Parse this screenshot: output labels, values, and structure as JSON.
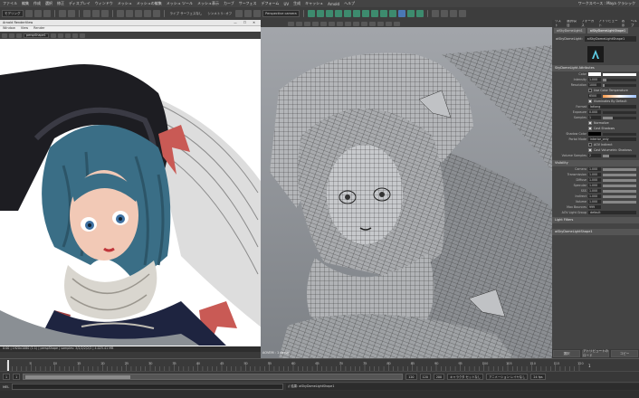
{
  "menubar": {
    "items": [
      "ファイル",
      "編集",
      "作成",
      "選択",
      "修正",
      "ディスプレイ",
      "ウィンドウ",
      "メッシュ",
      "メッシュの編集",
      "メッシュ ツール",
      "メッシュ表示",
      "カーブ",
      "サーフェス",
      "デフォーム",
      "UV",
      "生成",
      "キャッシュ",
      "Arnold",
      "ヘルプ"
    ],
    "workspace": "ワークスペース : Maya クラシック"
  },
  "toolbar": {
    "mode_select": "モデリング",
    "camera_select": "Perspective camera",
    "live_label": "ライブ サーフェスなし",
    "symmetry_label": "シンメトリ: オフ"
  },
  "render_view": {
    "title": "Arnold RenderView",
    "controls": "— ☐ ✕",
    "menu": [
      "Window",
      "View",
      "Render"
    ],
    "camera_dd": "perspShape1",
    "status": "0:00 | 1920x1080 (1:1) | perspShape | samples: 3/2/2/2/2/2 | 4.025.41 MB"
  },
  "viewport": {
    "camera_label": "AOVEM : 1  persp"
  },
  "attribute_editor": {
    "tabs": [
      "リスト",
      "選択項目",
      "フォーカス",
      "アトリビュート",
      "表示",
      "ヘルプ"
    ],
    "node_tabs": [
      "aiSkyDomeLight1",
      "aiSkyDomeLightShape1"
    ],
    "node_type_label": "aiSkyDomeLight:",
    "node_name": "aiSkyDomeLightShape1",
    "section1": "SkyDomeLight Attributes",
    "color_label": "Color",
    "intensity_label": "Intensity",
    "intensity_value": "1.000",
    "intensity_level": 0.1,
    "resolution_label": "Resolution",
    "resolution_value": "1000",
    "resolution_level": 0.05,
    "use_color_temp_label": "Use Color Temperature",
    "temperature_value": "6500",
    "illuminates_label": "Illuminates By Default",
    "format_label": "Format",
    "format_value": "latlong",
    "exposure_label": "Exposure",
    "exposure_value": "0.000",
    "samples_label": "Samples",
    "samples_value": "1",
    "samples_level": 0.3,
    "normalize_label": "Normalize",
    "cast_shadows_label": "Cast Shadows",
    "shadow_color_label": "Shadow Color",
    "portal_mode_label": "Portal Mode",
    "portal_mode_value": "interior_only",
    "aov_indirect_label": "AOV Indirect",
    "cast_volumetric_label": "Cast Volumetric Shadows",
    "volume_samples_label": "Volume Samples",
    "volume_samples_value": "2",
    "volume_samples_level": 0.2,
    "section2": "Visibility",
    "vis_rows": [
      {
        "label": "Camera",
        "value": "1.000"
      },
      {
        "label": "Transmission",
        "value": "1.000"
      },
      {
        "label": "Diffuse",
        "value": "1.000"
      },
      {
        "label": "Specular",
        "value": "1.000"
      },
      {
        "label": "SSS",
        "value": "1.000"
      },
      {
        "label": "Indirect",
        "value": "1.000"
      },
      {
        "label": "Volume",
        "value": "1.000"
      }
    ],
    "max_bounces_label": "Max Bounces",
    "max_bounces_value": "999",
    "aov_group_label": "AOV Light Group",
    "aov_group_value": "default",
    "section3": "Light Filters",
    "section4": "aiSkyDomeLightShape1",
    "footer_select": "選択",
    "footer_load": "アトリビュートのロード",
    "footer_copy": "コピー"
  },
  "timeline": {
    "ticks": [
      "5",
      "10",
      "15",
      "20",
      "25",
      "30",
      "35",
      "40",
      "45",
      "50",
      "55",
      "60",
      "65",
      "70",
      "75",
      "80",
      "85",
      "90",
      "95",
      "100",
      "105",
      "110",
      "115",
      "120"
    ],
    "current_frame": "1",
    "end_frame": "120"
  },
  "range": {
    "start": "1",
    "start2": "1",
    "end": "120",
    "end2": "120",
    "anim_end": "200",
    "char_set": "キャラクタ セットなし",
    "anim_layer": "アニメーション レイヤなし",
    "fps": "24 fps"
  },
  "cmdline": {
    "label": "MEL",
    "result": "// 結果: aiSkyDomeLightShape1"
  },
  "colors": {
    "accent_shelf": "#3d8b6e",
    "panel_bg": "#444444",
    "viewport_bg": "#9a9ea3"
  }
}
